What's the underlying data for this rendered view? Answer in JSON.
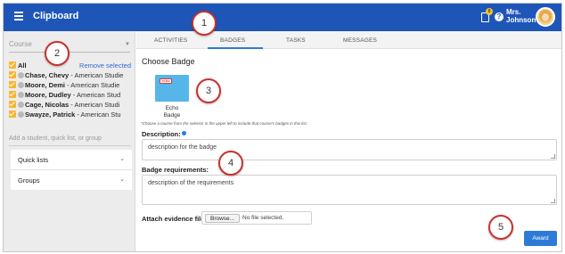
{
  "app": {
    "title": "Clipboard"
  },
  "header": {
    "notification_count": "0",
    "help_glyph": "?",
    "user_name_line1": "Mrs.",
    "user_name_line2": "Johnson"
  },
  "sidebar": {
    "course_placeholder": "Course",
    "all_label": "All",
    "remove_selected": "Remove selected",
    "students": [
      {
        "name": "Chase, Chevy",
        "course": " - American Studie"
      },
      {
        "name": "Moore, Demi",
        "course": " - American Studie"
      },
      {
        "name": "Moore, Dudley",
        "course": " - American Stud"
      },
      {
        "name": "Cage, Nicolas",
        "course": " - American Studi"
      },
      {
        "name": "Swayze, Patrick",
        "course": " - American Stu"
      }
    ],
    "add_placeholder": "Add a student, quick list, or group",
    "accordions": [
      {
        "label": "Quick lists"
      },
      {
        "label": "Groups"
      }
    ]
  },
  "tabs": [
    {
      "label": "ACTIVITIES"
    },
    {
      "label": "BADGES"
    },
    {
      "label": "TASKS"
    },
    {
      "label": "MESSAGES"
    }
  ],
  "main": {
    "choose_title": "Choose Badge",
    "badge": {
      "emblem_text": "echo",
      "name_line1": "Echo",
      "name_line2": "Badge"
    },
    "hint": "*Choose a course from the selector in the upper left to include that course's badges in this list.",
    "description_label": "Description:",
    "description_value": "description for the badge",
    "requirements_label": "Badge requirements:",
    "requirements_value": "description of the requirements",
    "attach_label": "Attach evidence file:",
    "browse_label": "Browse...",
    "file_status": "No file selected.",
    "award_label": "Award"
  },
  "callouts": [
    "1",
    "2",
    "3",
    "4",
    "5"
  ],
  "colors": {
    "topbar": "#1e56b8",
    "accent": "#2e7bd6",
    "checkbox": "#f5b731",
    "badge_tile": "#56b6ea",
    "callout_border": "#c9302c"
  },
  "icons": [
    "hamburger-icon",
    "clipboard-icon",
    "help-icon",
    "avatar",
    "person-icon",
    "chevron-down-icon",
    "info-icon"
  ]
}
